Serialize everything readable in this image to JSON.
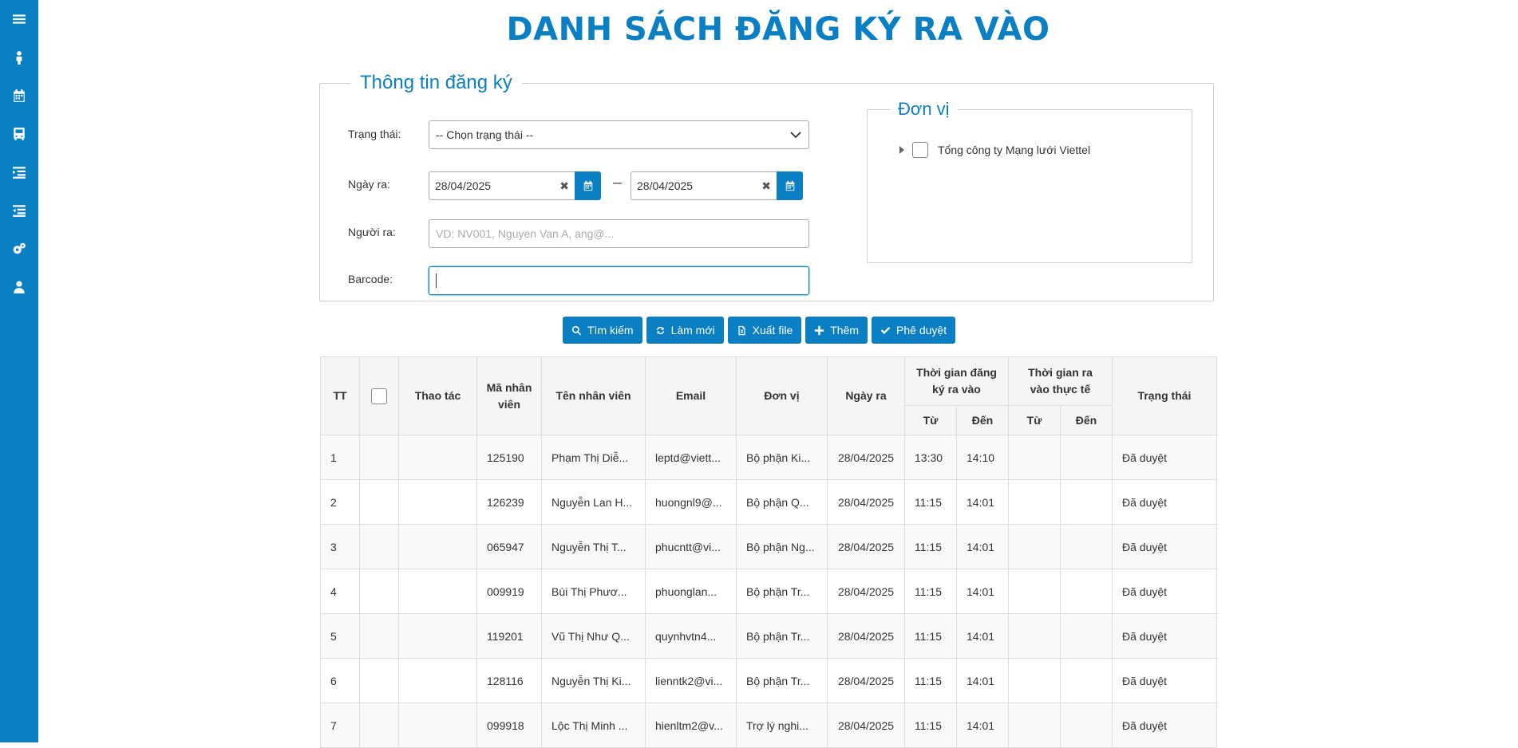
{
  "page": {
    "title": "DANH SÁCH ĐĂNG KÝ RA VÀO"
  },
  "sidebar": {
    "icons": [
      "menu-icon",
      "person-icon",
      "calendar-icon",
      "bus-icon",
      "list-indent-icon",
      "list-outdent-icon",
      "settings-icon",
      "user-icon"
    ]
  },
  "form": {
    "legend": "Thông tin đăng ký",
    "status_label": "Trạng thái:",
    "status_value": "-- Chọn trạng thái --",
    "date_label": "Ngày ra:",
    "date_from": "28/04/2025",
    "date_to": "28/04/2025",
    "date_separator": "–",
    "person_label": "Người ra:",
    "person_placeholder": "VD: NV001, Nguyen Van A, ang@...",
    "barcode_label": "Barcode:",
    "barcode_value": ""
  },
  "unit": {
    "legend": "Đơn vị",
    "tree_root": "Tổng công ty Mạng lưới Viettel"
  },
  "buttons": {
    "search": "Tìm kiếm",
    "refresh": "Làm mới",
    "export": "Xuất file",
    "add": "Thêm",
    "approve": "Phê duyệt"
  },
  "table": {
    "headers": {
      "tt": "TT",
      "action": "Thao tác",
      "code": "Mã nhân viên",
      "name": "Tên nhân viên",
      "email": "Email",
      "unit": "Đơn vị",
      "date": "Ngày ra",
      "reg_time": "Thời gian đăng ký ra vào",
      "actual_time": "Thời gian ra vào thực tế",
      "status": "Trạng thái",
      "from": "Từ",
      "to": "Đến"
    },
    "rows": [
      {
        "tt": "1",
        "code": "125190",
        "name": "Phạm Thị Diễ...",
        "email": "leptd@viett...",
        "unit": "Bộ phận Ki...",
        "date": "28/04/2025",
        "reg_from": "13:30",
        "reg_to": "14:10",
        "act_from": "",
        "act_to": "",
        "status": "Đã duyệt"
      },
      {
        "tt": "2",
        "code": "126239",
        "name": "Nguyễn Lan H...",
        "email": "huongnl9@...",
        "unit": "Bộ phận Q...",
        "date": "28/04/2025",
        "reg_from": "11:15",
        "reg_to": "14:01",
        "act_from": "",
        "act_to": "",
        "status": "Đã duyệt"
      },
      {
        "tt": "3",
        "code": "065947",
        "name": "Nguyễn Thị T...",
        "email": "phucntt@vi...",
        "unit": "Bộ phận Ng...",
        "date": "28/04/2025",
        "reg_from": "11:15",
        "reg_to": "14:01",
        "act_from": "",
        "act_to": "",
        "status": "Đã duyệt"
      },
      {
        "tt": "4",
        "code": "009919",
        "name": "Bùi Thị Phươ...",
        "email": "phuonglan...",
        "unit": "Bộ phận Tr...",
        "date": "28/04/2025",
        "reg_from": "11:15",
        "reg_to": "14:01",
        "act_from": "",
        "act_to": "",
        "status": "Đã duyệt"
      },
      {
        "tt": "5",
        "code": "119201",
        "name": "Vũ Thị Như Q...",
        "email": "quynhvtn4...",
        "unit": "Bộ phận Tr...",
        "date": "28/04/2025",
        "reg_from": "11:15",
        "reg_to": "14:01",
        "act_from": "",
        "act_to": "",
        "status": "Đã duyệt"
      },
      {
        "tt": "6",
        "code": "128116",
        "name": "Nguyễn Thị Ki...",
        "email": "lienntk2@vi...",
        "unit": "Bộ phận Tr...",
        "date": "28/04/2025",
        "reg_from": "11:15",
        "reg_to": "14:01",
        "act_from": "",
        "act_to": "",
        "status": "Đã duyệt"
      },
      {
        "tt": "7",
        "code": "099918",
        "name": "Lộc Thị Minh ...",
        "email": "hienltm2@v...",
        "unit": "Trợ lý nghi...",
        "date": "28/04/2025",
        "reg_from": "11:15",
        "reg_to": "14:01",
        "act_from": "",
        "act_to": "",
        "status": "Đã duyệt"
      }
    ]
  }
}
